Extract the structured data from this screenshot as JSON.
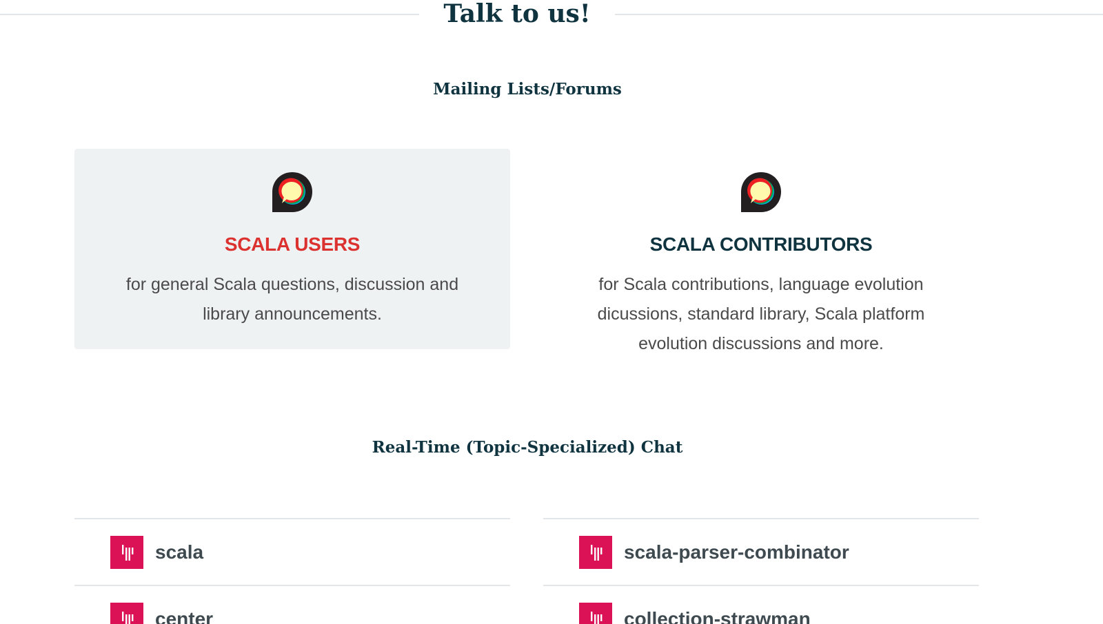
{
  "header": {
    "title": "Talk to us!"
  },
  "forums": {
    "heading": "Mailing Lists/Forums",
    "cards": [
      {
        "title": "SCALA USERS",
        "description": "for general Scala questions, discussion and library announcements.",
        "icon": "discourse-icon"
      },
      {
        "title": "SCALA CONTRIBUTORS",
        "description": "for Scala contributions, language evolution dicussions, standard library, Scala platform evolution discussions and more.",
        "icon": "discourse-icon"
      }
    ]
  },
  "chat": {
    "heading": "Real-Time (Topic-Specialized) Chat",
    "left_items": [
      {
        "name": "scala",
        "icon": "gitter-icon"
      },
      {
        "name": "center",
        "icon": "gitter-icon"
      }
    ],
    "right_items": [
      {
        "name": "scala-parser-combinator",
        "icon": "gitter-icon"
      },
      {
        "name": "collection-strawman",
        "icon": "gitter-icon"
      }
    ]
  },
  "colors": {
    "heading": "#0f3440",
    "accent_red": "#dc322f",
    "gitter_pink": "#db1356",
    "card_bg": "#eff2f3",
    "divider": "#e3e6e8"
  }
}
